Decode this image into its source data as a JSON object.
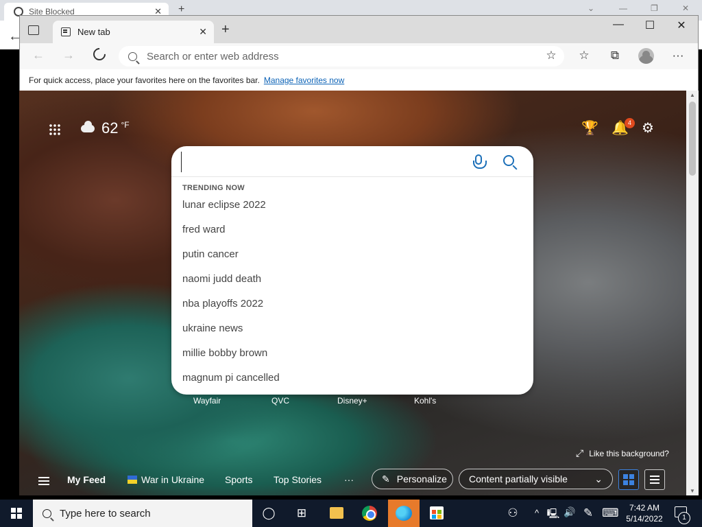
{
  "background_window": {
    "tab_title": "Site Blocked",
    "tab_close": "✕",
    "new_tab": "+",
    "back": "←",
    "controls": [
      "⌄",
      "—",
      "❐",
      "✕"
    ]
  },
  "titlebar": {
    "tab_title": "New tab",
    "tab_close": "✕",
    "new_tab": "+",
    "minimize": "—",
    "maximize": "☐",
    "close": "✕"
  },
  "toolbar": {
    "back": "←",
    "forward": "→",
    "address_placeholder": "Search or enter web address",
    "add_favorite": "☆",
    "favorites": "☆",
    "collections": "⧉",
    "more": "···"
  },
  "favorites_bar": {
    "message": "For quick access, place your favorites here on the favorites bar.",
    "link": "Manage favorites now"
  },
  "weather": {
    "temperature": "62",
    "unit": "°F"
  },
  "header_icons": {
    "rewards": "🏆",
    "notifications": "🔔",
    "notification_count": "4",
    "settings": "⚙"
  },
  "search": {
    "heading": "TRENDING NOW",
    "suggestions": [
      "lunar eclipse 2022",
      "fred ward",
      "putin cancer",
      "naomi judd death",
      "nba playoffs 2022",
      "ukraine news",
      "millie bobby brown",
      "magnum pi cancelled"
    ]
  },
  "quick_links": [
    "Wayfair",
    "QVC",
    "Disney+",
    "Kohl's"
  ],
  "background_prompt": {
    "icon": "⤢",
    "label": "Like this background?"
  },
  "feed": {
    "my_feed": "My Feed",
    "war_in_ukraine": "War in Ukraine",
    "sports": "Sports",
    "top_stories": "Top Stories",
    "more": "···",
    "personalize": "Personalize",
    "content_visibility": "Content partially visible",
    "dropdown_chevron": "⌄"
  },
  "taskbar": {
    "search_placeholder": "Type here to search",
    "task_view": "◯",
    "widgets": "⊞",
    "people": "⚇",
    "tray_up": "^",
    "network": "🖳",
    "volume": "🔊",
    "pen": "✎",
    "keyboard": "⌨",
    "time": "7:42 AM",
    "date": "5/14/2022",
    "notification_count": "1"
  }
}
